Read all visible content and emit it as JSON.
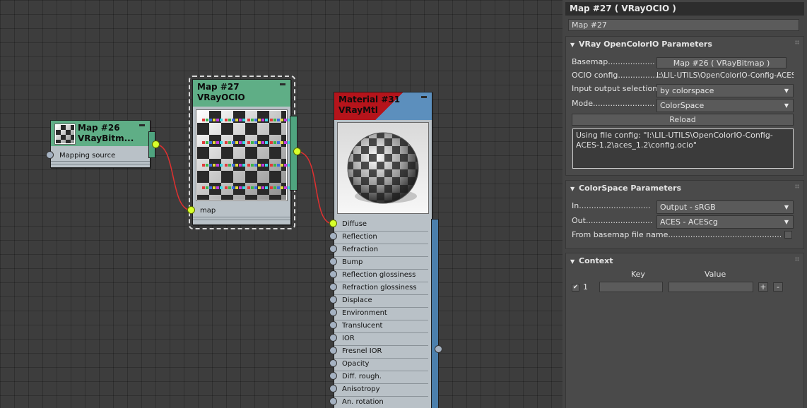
{
  "nodes": {
    "bitmap": {
      "title1": "Map #26",
      "title2": "VRayBitm...",
      "slot": "Mapping source",
      "color": "#5fae86"
    },
    "ocio": {
      "title1": "Map #27",
      "title2": "VRayOCIO",
      "slot": "map",
      "color": "#5fae86"
    },
    "material": {
      "title1": "Material #31",
      "title2": "VRayMtl",
      "header_colors": [
        "#b5141b",
        "#5c8fbd"
      ],
      "slots": [
        "Diffuse",
        "Reflection",
        "Refraction",
        "Bump",
        "Reflection glossiness",
        "Refraction glossiness",
        "Displace",
        "Environment",
        "Translucent",
        "IOR",
        "Fresnel IOR",
        "Opacity",
        "Diff. rough.",
        "Anisotropy",
        "An. rotation"
      ],
      "connected_slot": "Diffuse"
    }
  },
  "panel": {
    "title": "Map #27  ( VRayOCIO )",
    "name_field": "Map #27",
    "ocio_rollout": {
      "title": "VRay OpenColorIO Parameters",
      "basemap_label": "Basemap...................",
      "basemap_value": "Map #26  ( VRayBitmap )",
      "config_label": "OCIO config..................",
      "config_value": "I:\\LIL-UTILS\\OpenColorIO-Config-ACES-",
      "iosel_label": "Input output selection......",
      "iosel_value": "by colorspace",
      "mode_label": "Mode.........................",
      "mode_value": "ColorSpace",
      "reload": "Reload",
      "status_text": "Using file config: \"I:\\LIL-UTILS\\OpenColorIO-Config-ACES-1.2\\aces_1.2\\config.ocio\""
    },
    "cs_rollout": {
      "title": "ColorSpace Parameters",
      "in_label": "In.............................",
      "in_value": "Output - sRGB",
      "out_label": "Out...........................",
      "out_value": "ACES - ACEScg",
      "from_label": "From basemap file name..............................................",
      "from_checked": false
    },
    "ctx_rollout": {
      "title": "Context",
      "key_header": "Key",
      "value_header": "Value",
      "row_index": "1",
      "row_checked": true,
      "add": "+",
      "remove": "-"
    }
  }
}
